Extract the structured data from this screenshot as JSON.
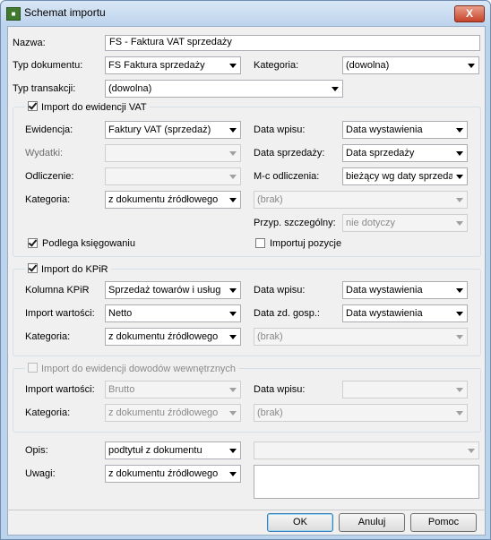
{
  "window": {
    "title": "Schemat importu",
    "close_label": "X"
  },
  "header": {
    "nazwa_label": "Nazwa:",
    "nazwa_value": "FS - Faktura VAT sprzedaży",
    "typ_dokumentu_label": "Typ dokumentu:",
    "typ_dokumentu_value": "FS Faktura sprzedaży",
    "kategoria_label": "Kategoria:",
    "kategoria_value": "(dowolna)",
    "typ_transakcji_label": "Typ transakcji:",
    "typ_transakcji_value": "(dowolna)"
  },
  "vat": {
    "title": "Import do ewidencji VAT",
    "ewidencja_label": "Ewidencja:",
    "ewidencja_value": "Faktury VAT (sprzedaż)",
    "wydatki_label": "Wydatki:",
    "wydatki_value": "",
    "odliczenie_label": "Odliczenie:",
    "odliczenie_value": "",
    "kategoria_label": "Kategoria:",
    "kategoria_value": "z dokumentu źródłowego",
    "data_wpisu_label": "Data wpisu:",
    "data_wpisu_value": "Data wystawienia",
    "data_sprzedazy_label": "Data sprzedaży:",
    "data_sprzedazy_value": "Data sprzedaży",
    "mc_odliczenia_label": "M-c odliczenia:",
    "mc_odliczenia_value": "bieżący wg daty sprzedaży",
    "kategoria2_value": "(brak)",
    "przyp_label": "Przyp. szczególny:",
    "przyp_value": "nie dotyczy",
    "podlega_label": "Podlega księgowaniu",
    "importuj_label": "Importuj pozycje"
  },
  "kpir": {
    "title": "Import do KPiR",
    "kolumna_label": "Kolumna KPiR",
    "kolumna_value": "Sprzedaż towarów i usług",
    "import_wartosci_label": "Import wartości:",
    "import_wartosci_value": "Netto",
    "kategoria_label": "Kategoria:",
    "kategoria_value": "z dokumentu źródłowego",
    "data_wpisu_label": "Data wpisu:",
    "data_wpisu_value": "Data wystawienia",
    "data_zd_label": "Data zd. gosp.:",
    "data_zd_value": "Data wystawienia",
    "kategoria2_value": "(brak)"
  },
  "dowody": {
    "title": "Import do ewidencji dowodów wewnętrznych",
    "import_wartosci_label": "Import wartości:",
    "import_wartosci_value": "Brutto",
    "kategoria_label": "Kategoria:",
    "kategoria_value": "z dokumentu źródłowego",
    "data_wpisu_label": "Data wpisu:",
    "data_wpisu_value": "",
    "kategoria2_value": "(brak)"
  },
  "bottom": {
    "opis_label": "Opis:",
    "opis_value": "podtytuł z dokumentu",
    "opis2_value": "",
    "uwagi_label": "Uwagi:",
    "uwagi_value": "z dokumentu źródłowego"
  },
  "buttons": {
    "ok": "OK",
    "cancel": "Anuluj",
    "help": "Pomoc"
  }
}
